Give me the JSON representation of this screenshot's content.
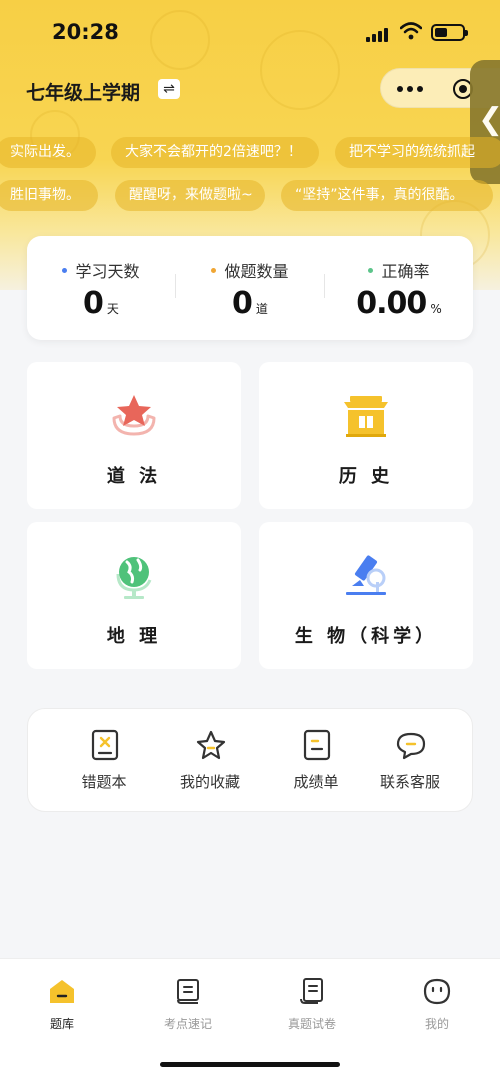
{
  "status": {
    "time": "20:28"
  },
  "header": {
    "semester": "七年级上学期",
    "swap_symbol": "⇌"
  },
  "ticker": {
    "row1": [
      "实际出发。",
      "大家不会都开的2倍速吧？！",
      "把不学习的统统抓起"
    ],
    "row2": [
      "胜旧事物。",
      "醒醒呀，来做题啦~",
      "“坚持”这件事，真的很酷。"
    ]
  },
  "stats": [
    {
      "label": "学习天数",
      "value": "0",
      "unit": "天",
      "dot_color": "#4a7ef0"
    },
    {
      "label": "做题数量",
      "value": "0",
      "unit": "道",
      "dot_color": "#f0a634"
    },
    {
      "label": "正确率",
      "value": "0.00",
      "unit": "%",
      "dot_color": "#5cc48a"
    }
  ],
  "subjects": [
    {
      "name": "道 法",
      "icon": "star-icon"
    },
    {
      "name": "历 史",
      "icon": "temple-icon"
    },
    {
      "name": "地 理",
      "icon": "globe-icon"
    },
    {
      "name": "生 物（科学）",
      "icon": "microscope-icon"
    }
  ],
  "tools": [
    {
      "label": "错题本",
      "icon": "wrong-book-icon"
    },
    {
      "label": "我的收藏",
      "icon": "star-outline-icon"
    },
    {
      "label": "成绩单",
      "icon": "report-icon"
    },
    {
      "label": "联系客服",
      "icon": "chat-icon"
    }
  ],
  "tabs": [
    {
      "label": "题库",
      "icon": "home-icon",
      "active": true
    },
    {
      "label": "考点速记",
      "icon": "book-icon",
      "active": false
    },
    {
      "label": "真题试卷",
      "icon": "scroll-icon",
      "active": false
    },
    {
      "label": "我的",
      "icon": "face-icon",
      "active": false
    }
  ],
  "colors": {
    "accent": "#f7cf45",
    "active_tab": "#f5c22c"
  }
}
